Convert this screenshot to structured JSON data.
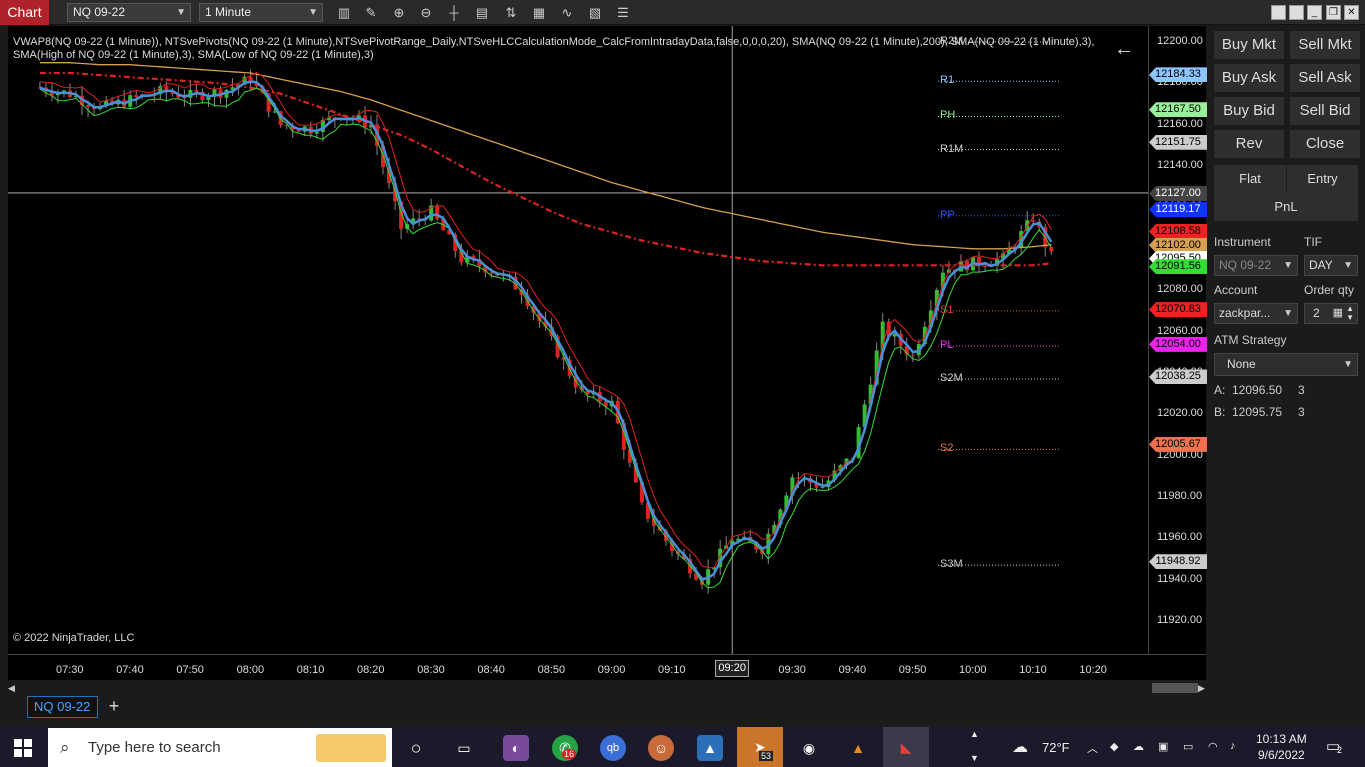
{
  "toolbar": {
    "chart_label": "Chart",
    "instrument": "NQ 09-22",
    "interval": "1 Minute"
  },
  "chart": {
    "indicator_text": "VWAP8(NQ 09-22 (1 Minute)), NTSvePivots(NQ 09-22 (1 Minute),NTSvePivotRange_Daily,NTSveHLCCalculationMode_CalcFromIntradayData,false,0,0,0,20), SMA(NQ 09-22 (1 Minute),200), SMA(NQ 09-22 (1 Minute),3), SMA(High of NQ 09-22 (1 Minute),3), SMA(Low of NQ 09-22 (1 Minute),3)",
    "copyright": "© 2022 NinjaTrader, LLC",
    "colors": {
      "up": "#33bb33",
      "down": "#dd2222",
      "sma200": "#d4a050",
      "vwap": "#dd2222",
      "sma3": "#4a90d9",
      "high_sma": "#e02020",
      "low_sma": "#33dd33"
    },
    "pivot_labels": [
      {
        "text": "R2M",
        "color": "#cccccc",
        "value": 12200.0
      },
      {
        "text": "R1",
        "color": "#8ec7ff",
        "value": 12181.0
      },
      {
        "text": "PH",
        "color": "#99ee99",
        "value": 12164.0
      },
      {
        "text": "R1M",
        "color": "#cccccc",
        "value": 12148.0
      },
      {
        "text": "PP",
        "color": "#3355ff",
        "value": 12116.0
      },
      {
        "text": "S1",
        "color": "#ee3333",
        "value": 12070.0
      },
      {
        "text": "PL",
        "color": "#ee33ee",
        "value": 12053.0
      },
      {
        "text": "S2M",
        "color": "#cccccc",
        "value": 12037.0
      },
      {
        "text": "S2",
        "color": "#f07050",
        "value": 12003.0
      },
      {
        "text": "S3M",
        "color": "#cccccc",
        "value": 11947.0
      }
    ],
    "price_ticks": [
      "12200.00",
      "12180.00",
      "12160.00",
      "12140.00",
      "12120.00",
      "12100.00",
      "12080.00",
      "12060.00",
      "12040.00",
      "12020.00",
      "12000.00",
      "11980.00",
      "11960.00",
      "11940.00",
      "11920.00"
    ],
    "price_tags": [
      {
        "text": "12184.33",
        "bg": "#8ec7ff",
        "value": 12184.33
      },
      {
        "text": "12167.50",
        "bg": "#99ee99",
        "value": 12167.5
      },
      {
        "text": "12151.75",
        "bg": "#cccccc",
        "value": 12151.75
      },
      {
        "text": "12127.00",
        "bg": "#444444",
        "value": 12127.0
      },
      {
        "text": "12119.17",
        "bg": "#1133ff",
        "value": 12119.17
      },
      {
        "text": "12108.58",
        "bg": "#ee2222",
        "value": 12108.58
      },
      {
        "text": "12102.00",
        "bg": "#d4a050",
        "value": 12102.0
      },
      {
        "text": "12095.50",
        "bg": "#ffffff",
        "value": 12095.5
      },
      {
        "text": "12091.56",
        "bg": "#33dd33",
        "value": 12091.56
      },
      {
        "text": "12070.83",
        "bg": "#ee2222",
        "value": 12070.83
      },
      {
        "text": "12054.00",
        "bg": "#ee22ee",
        "value": 12054.0
      },
      {
        "text": "12038.25",
        "bg": "#cccccc",
        "value": 12038.25
      },
      {
        "text": "12005.67",
        "bg": "#f07050",
        "value": 12005.67
      },
      {
        "text": "11948.92",
        "bg": "#cccccc",
        "value": 11948.92
      }
    ],
    "time_ticks": [
      "07:30",
      "07:40",
      "07:50",
      "08:00",
      "08:10",
      "08:20",
      "08:30",
      "08:40",
      "08:50",
      "09:00",
      "09:10",
      "09:20",
      "09:30",
      "09:40",
      "09:50",
      "10:00",
      "10:10",
      "10:20"
    ],
    "time_cursor": "09:20",
    "crosshair_price": 12127.0,
    "price_range": [
      11910,
      12205
    ]
  },
  "chart_data": {
    "type": "candlestick",
    "symbol": "NQ 09-22",
    "interval": "1 Minute",
    "x": [
      "07:25",
      "07:30",
      "07:35",
      "07:40",
      "07:45",
      "07:50",
      "07:55",
      "08:00",
      "08:05",
      "08:10",
      "08:15",
      "08:20",
      "08:25",
      "08:30",
      "08:35",
      "08:40",
      "08:45",
      "08:50",
      "08:55",
      "09:00",
      "09:05",
      "09:10",
      "09:15",
      "09:20",
      "09:25",
      "09:30",
      "09:35",
      "09:40",
      "09:45",
      "09:50",
      "09:55",
      "10:00",
      "10:05",
      "10:10",
      "10:13"
    ],
    "close": [
      12178,
      12175,
      12168,
      12172,
      12176,
      12174,
      12176,
      12182,
      12160,
      12158,
      12165,
      12160,
      12110,
      12118,
      12095,
      12090,
      12080,
      12055,
      12030,
      12025,
      11975,
      11955,
      11940,
      11960,
      11955,
      11990,
      11985,
      12000,
      12062,
      12048,
      12090,
      12093,
      12095,
      12115,
      12096
    ],
    "sma200": [
      12190,
      12190,
      12189,
      12189,
      12188,
      12187,
      12186,
      12185,
      12182,
      12179,
      12176,
      12172,
      12167,
      12162,
      12157,
      12152,
      12147,
      12142,
      12137,
      12132,
      12128,
      12124,
      12120,
      12117,
      12114,
      12111,
      12108,
      12106,
      12104,
      12102,
      12101,
      12100,
      12100,
      12101,
      12102
    ],
    "vwap": [
      12185,
      12185,
      12184,
      12183,
      12182,
      12181,
      12180,
      12178,
      12175,
      12170,
      12165,
      12160,
      12155,
      12148,
      12140,
      12132,
      12125,
      12118,
      12112,
      12108,
      12104,
      12101,
      12098,
      12096,
      12094,
      12093,
      12092,
      12092,
      12092,
      12092,
      12092,
      12092,
      12092,
      12092,
      12093
    ],
    "ylim": [
      11910,
      12205
    ],
    "xlabel": "",
    "ylabel": ""
  },
  "panel": {
    "buy_mkt": "Buy Mkt",
    "sell_mkt": "Sell Mkt",
    "buy_ask": "Buy Ask",
    "sell_ask": "Sell Ask",
    "buy_bid": "Buy Bid",
    "sell_bid": "Sell Bid",
    "rev": "Rev",
    "close": "Close",
    "flat": "Flat",
    "entry": "Entry",
    "pnl": "PnL",
    "instrument_label": "Instrument",
    "tif_label": "TIF",
    "instrument_value": "NQ 09-22",
    "tif_value": "DAY",
    "account_label": "Account",
    "order_qty_label": "Order qty",
    "account_value": "zackpar...",
    "order_qty_value": "2",
    "atm_label": "ATM Strategy",
    "atm_value": "None",
    "ask_label": "A:",
    "ask_price": "12096.50",
    "ask_size": "3",
    "bid_label": "B:",
    "bid_price": "12095.75",
    "bid_size": "3"
  },
  "tabs": {
    "active": "NQ 09-22",
    "add": "+"
  },
  "taskbar": {
    "search_placeholder": "Type here to search",
    "whatsapp_badge": "16",
    "telegram_badge": "53",
    "weather": "72°F",
    "time": "10:13 AM",
    "date": "9/6/2022",
    "notifications": "2"
  }
}
